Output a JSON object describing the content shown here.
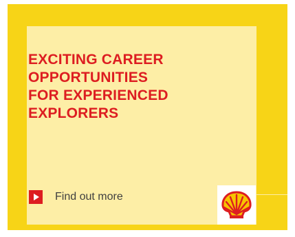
{
  "ad": {
    "headline_lines": [
      "EXCITING CAREER",
      "OPPORTUNITIES",
      "FOR EXPERIENCED",
      "EXPLORERS"
    ],
    "cta_label": "Find out more",
    "play_icon": "play-icon",
    "logo_icon": "shell-pecten-logo"
  },
  "colors": {
    "outer_yellow": "#f7d417",
    "panel_cream": "#fdeea6",
    "headline_red": "#dd1d21",
    "cta_text": "#404040"
  }
}
